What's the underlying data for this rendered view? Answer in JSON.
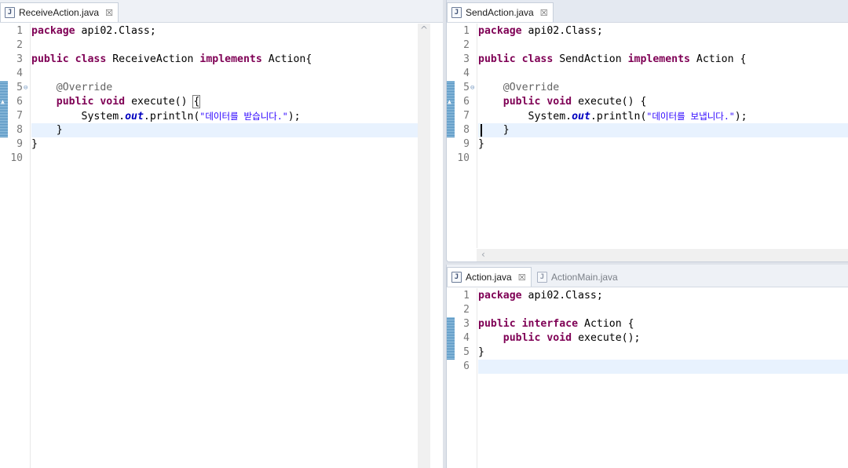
{
  "left_editor": {
    "tab": {
      "label": "ReceiveAction.java",
      "icon": "java-file-icon",
      "close": "☒"
    },
    "line_numbers": [
      "1",
      "2",
      "3",
      "4",
      "5",
      "6",
      "7",
      "8",
      "9",
      "10"
    ],
    "code": {
      "l1_kw": "package",
      "l1_rest": " api02.Class;",
      "l3_kw1": "public",
      "l3_kw2": "class",
      "l3_name": " ReceiveAction ",
      "l3_kw3": "implements",
      "l3_rest": " Action{",
      "l5_ann": "    @Override",
      "l6_kw1": "    public",
      "l6_kw2": "void",
      "l6_rest": " execute() ",
      "l6_brace": "{",
      "l7_pre": "        System.",
      "l7_field": "out",
      "l7_mid": ".println(",
      "l7_str": "\"데이터를 받습니다.\"",
      "l7_end": ");",
      "l8": "    }",
      "l9": "}"
    }
  },
  "right_top_editor": {
    "tab": {
      "label": "SendAction.java",
      "icon": "java-file-icon",
      "close": "☒"
    },
    "line_numbers": [
      "1",
      "2",
      "3",
      "4",
      "5",
      "6",
      "7",
      "8",
      "9",
      "10"
    ],
    "code": {
      "l1_kw": "package",
      "l1_rest": " api02.Class;",
      "l3_kw1": "public",
      "l3_kw2": "class",
      "l3_name": " SendAction ",
      "l3_kw3": "implements",
      "l3_rest": " Action {",
      "l5_ann": "    @Override",
      "l6_kw1": "    public",
      "l6_kw2": "void",
      "l6_rest": " execute() {",
      "l7_pre": "        System.",
      "l7_field": "out",
      "l7_mid": ".println(",
      "l7_str": "\"데이터를 보냅니다.\"",
      "l7_end": ");",
      "l8": "    }",
      "l9": "}"
    }
  },
  "right_bottom_editor": {
    "tabs": [
      {
        "label": "Action.java",
        "icon": "java-file-icon",
        "close": "☒",
        "active": true
      },
      {
        "label": "ActionMain.java",
        "icon": "java-file-icon",
        "active": false
      }
    ],
    "line_numbers": [
      "1",
      "2",
      "3",
      "4",
      "5",
      "6"
    ],
    "code": {
      "l1_kw": "package",
      "l1_rest": " api02.Class;",
      "l3_kw1": "public",
      "l3_kw2": "interface",
      "l3_rest": " Action {",
      "l4_kw1": "    public",
      "l4_kw2": "void",
      "l4_rest": " execute();",
      "l5": "}"
    }
  },
  "colors": {
    "keyword": "#7f0055",
    "annotation": "#646464",
    "field": "#0000c0",
    "string": "#2a00ff",
    "current_line": "#e8f2fe",
    "change_marker": "#5e9ec9"
  }
}
